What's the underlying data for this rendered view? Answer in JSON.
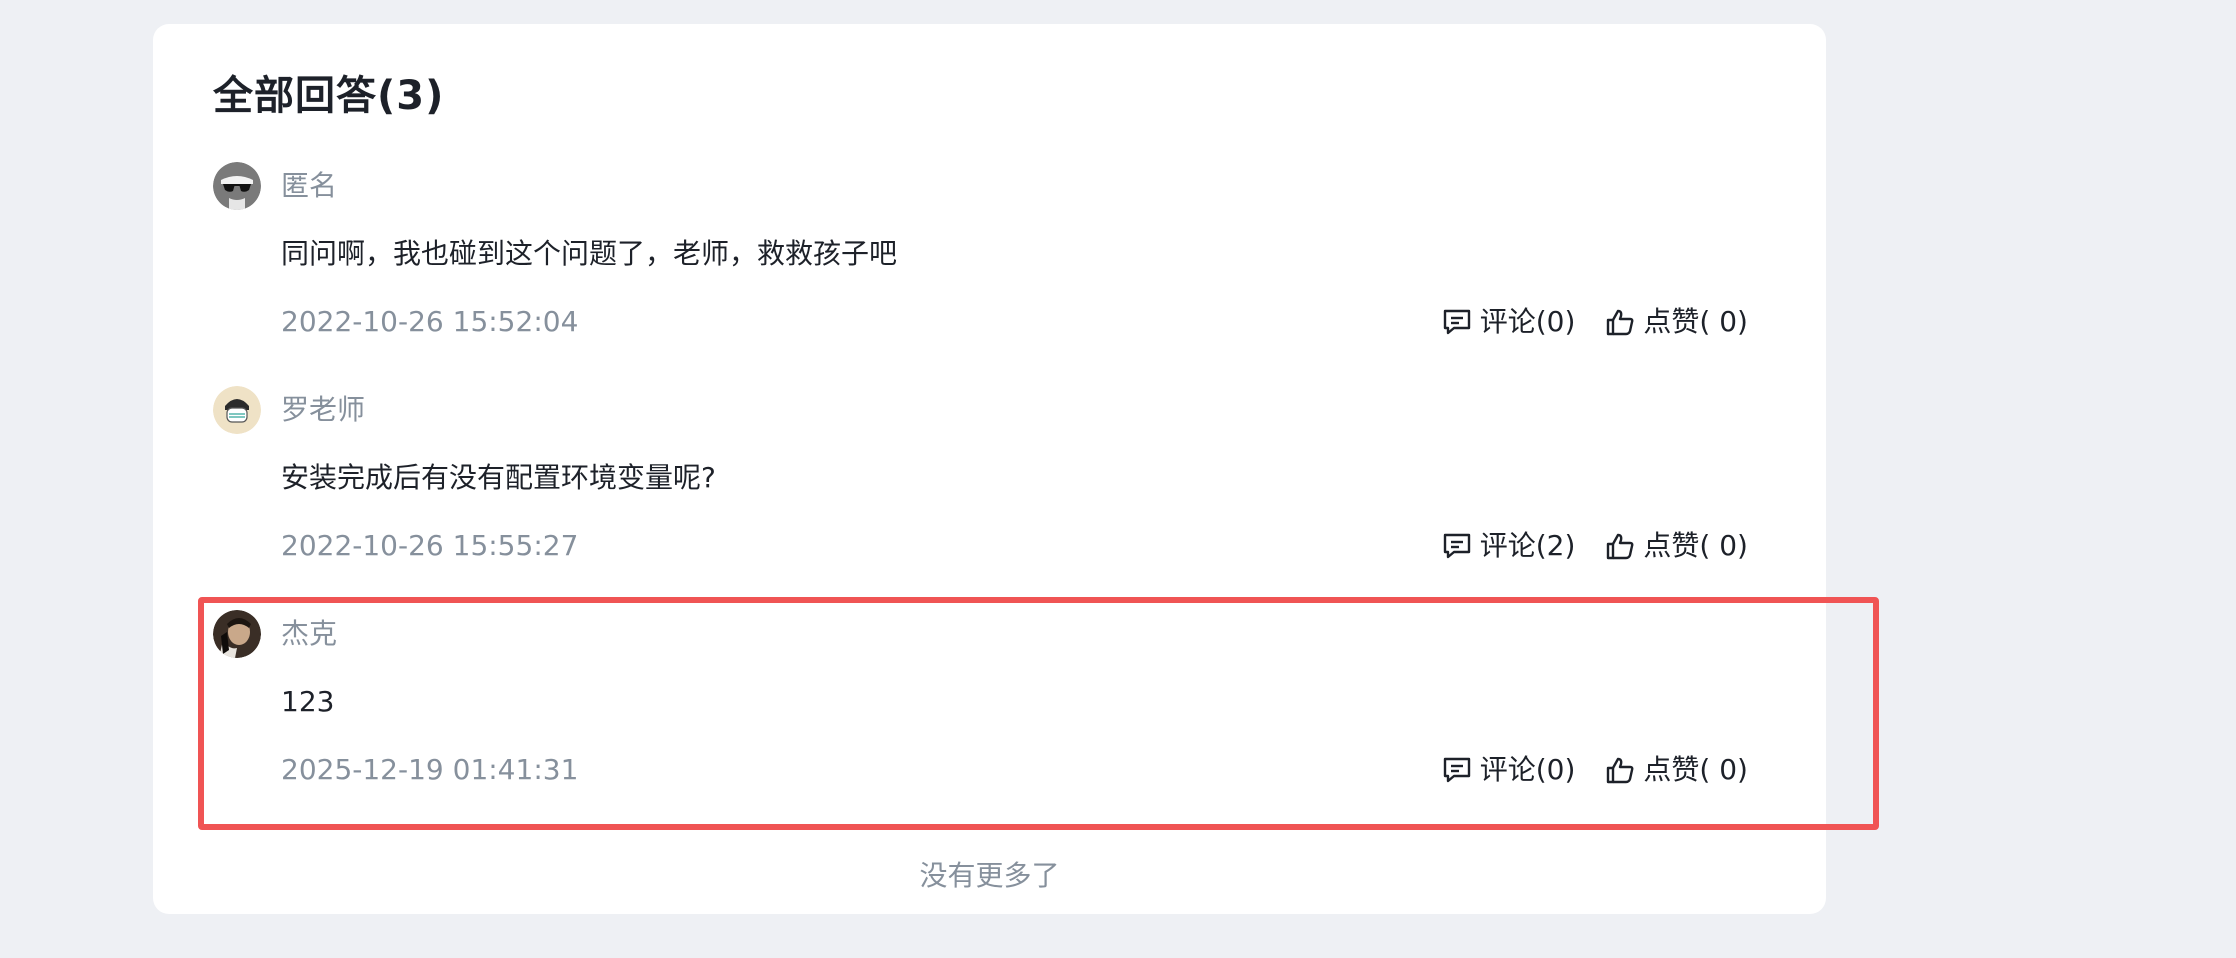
{
  "page": {
    "title": "全部回答(3)",
    "footer_text": "没有更多了"
  },
  "colors": {
    "background": "#eef0f4",
    "card": "#ffffff",
    "highlight_border": "#f05454",
    "text_primary": "#1d2129",
    "text_secondary": "#86909c"
  },
  "answers": [
    {
      "username": "匿名",
      "avatar_icon": "sunglasses-avatar-icon",
      "content": "同问啊，我也碰到这个问题了，老师，救救孩子吧",
      "time": "2022-10-26 15:52:04",
      "comment_label": "评论(0)",
      "like_label": "点赞( 0)"
    },
    {
      "username": "罗老师",
      "avatar_icon": "cartoon-avatar-icon",
      "content": "安装完成后有没有配置环境变量呢?",
      "time": "2022-10-26 15:55:27",
      "comment_label": "评论(2)",
      "like_label": "点赞( 0)"
    },
    {
      "username": "杰克",
      "avatar_icon": "photo-avatar-icon",
      "content": "123",
      "time": "2025-12-19 01:41:31",
      "comment_label": "评论(0)",
      "like_label": "点赞( 0)"
    }
  ]
}
